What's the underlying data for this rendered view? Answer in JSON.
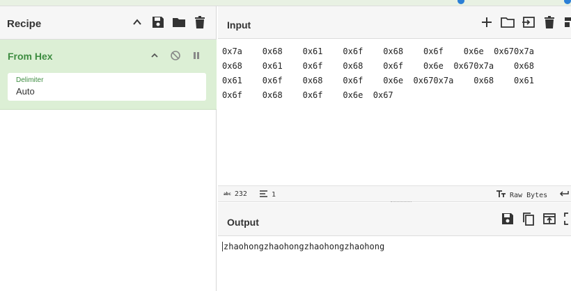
{
  "recipe": {
    "title": "Recipe",
    "operation": {
      "name": "From Hex",
      "arg_label": "Delimiter",
      "arg_value": "Auto"
    }
  },
  "input": {
    "title": "Input",
    "lines": [
      "0x7a    0x68    0x61    0x6f    0x68    0x6f    0x6e  0x670x7a",
      "0x68    0x61    0x6f    0x68    0x6f    0x6e  0x670x7a    0x68",
      "0x61    0x6f    0x68    0x6f    0x6e  0x670x7a    0x68    0x61",
      "0x6f    0x68    0x6f    0x6e  0x67"
    ]
  },
  "status": {
    "abc_label": "abc",
    "length": "232",
    "lines": "1",
    "encoding": "Raw Bytes"
  },
  "output": {
    "title": "Output",
    "text": "zhaohongzhaohongzhaohongzhaohong"
  },
  "colors": {
    "op_bg": "#dcefd5",
    "op_name": "#3d8c40",
    "pane_header_bg": "#f6f6f6"
  },
  "icons": {
    "recipe_header": [
      "chevron-up-icon",
      "save-icon",
      "folder-icon",
      "trash-icon"
    ],
    "op_controls": [
      "chevron-up-icon",
      "disable-icon",
      "pause-icon"
    ],
    "input_header": [
      "plus-icon",
      "open-folder-icon",
      "import-icon",
      "trash-icon",
      "layout-icon"
    ],
    "output_header": [
      "save-icon",
      "copy-icon",
      "replace-input-icon",
      "fullscreen-icon"
    ]
  }
}
